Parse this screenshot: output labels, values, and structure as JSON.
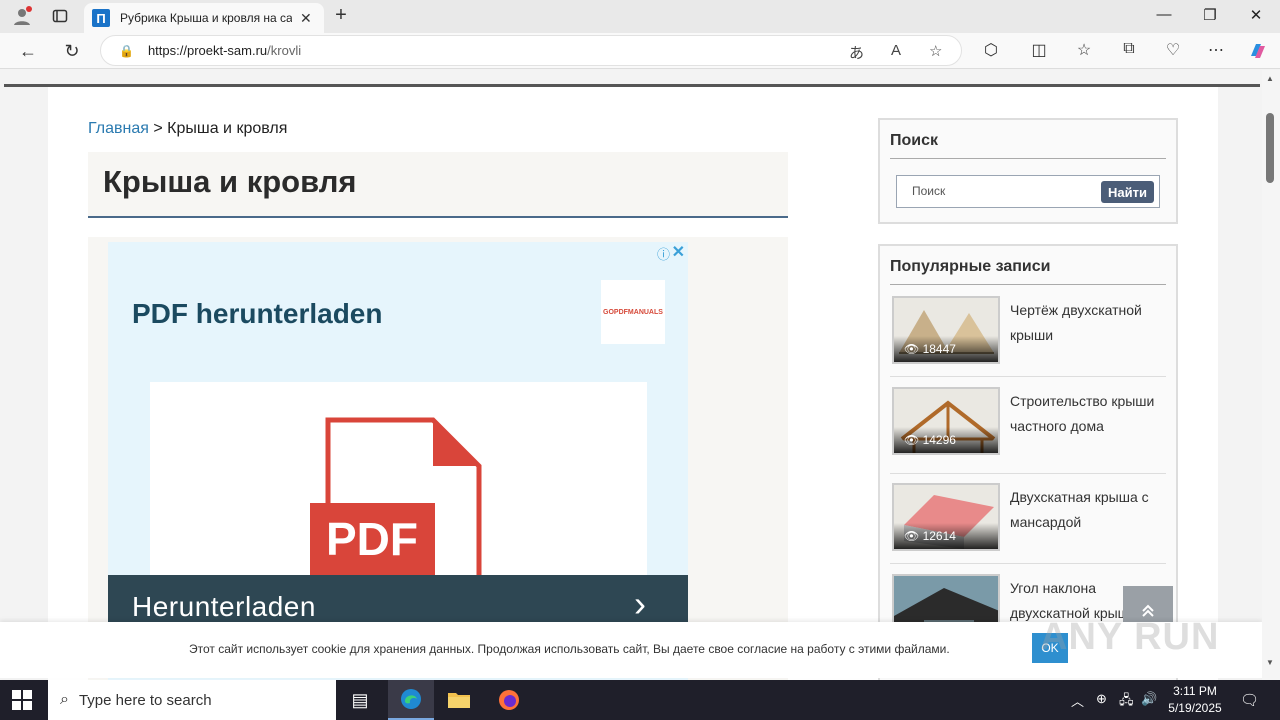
{
  "browser": {
    "tab_title": "Рубрика Крыша и кровля на са",
    "url_host": "https://proekt-sam.ru",
    "url_path": "/krovli"
  },
  "breadcrumb": {
    "home": "Главная",
    "separator": ">",
    "current": "Крыша и кровля"
  },
  "page_title": "Крыша и кровля",
  "ad": {
    "headline": "PDF herunterladen",
    "logo_text": "GOPDFMANUALS",
    "pdf_label": "PDF",
    "cta": "Herunterladen"
  },
  "search_widget": {
    "title": "Поиск",
    "placeholder": "Поиск",
    "button": "Найти"
  },
  "popular": {
    "title": "Популярные записи",
    "items": [
      {
        "label": "Чертёж двухскатной крыши",
        "views": "18447"
      },
      {
        "label": "Строительство крыши частного дома",
        "views": "14296"
      },
      {
        "label": "Двухскатная крыша с мансардой",
        "views": "12614"
      },
      {
        "label": "Угол наклона двухскатной крыши",
        "views": ""
      }
    ]
  },
  "cookie": {
    "text": "Этот сайт использует cookie для хранения данных. Продолжая использовать сайт, Вы даете свое согласие на работу с этими файлами.",
    "ok": "OK"
  },
  "watermark": "ANY RUN",
  "taskbar": {
    "search_placeholder": "Type here to search",
    "time": "3:11 PM",
    "date": "5/19/2025"
  }
}
